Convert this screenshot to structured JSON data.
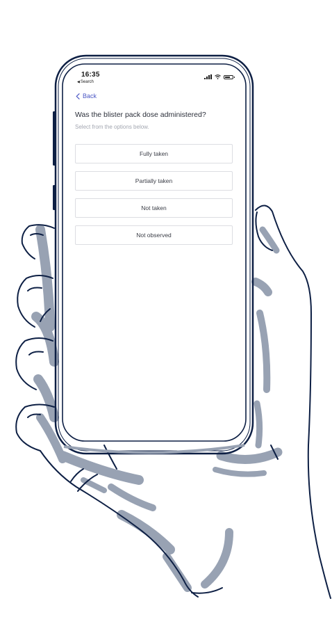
{
  "status_bar": {
    "time": "16:35",
    "back_app_label": "Search",
    "icons": [
      "signal-icon",
      "wifi-icon",
      "battery-icon"
    ]
  },
  "nav": {
    "back_label": "Back",
    "back_icon": "chevron-left-icon"
  },
  "question": {
    "title": "Was the blister pack dose administered?",
    "subtitle": "Select from the options below."
  },
  "options": [
    {
      "label": "Fully taken"
    },
    {
      "label": "Partially taken"
    },
    {
      "label": "Not taken"
    },
    {
      "label": "Not observed"
    }
  ],
  "colors": {
    "accent": "#4a56c4",
    "line_art": "#0d1f44",
    "hand_shadow": "#98a2b3"
  }
}
